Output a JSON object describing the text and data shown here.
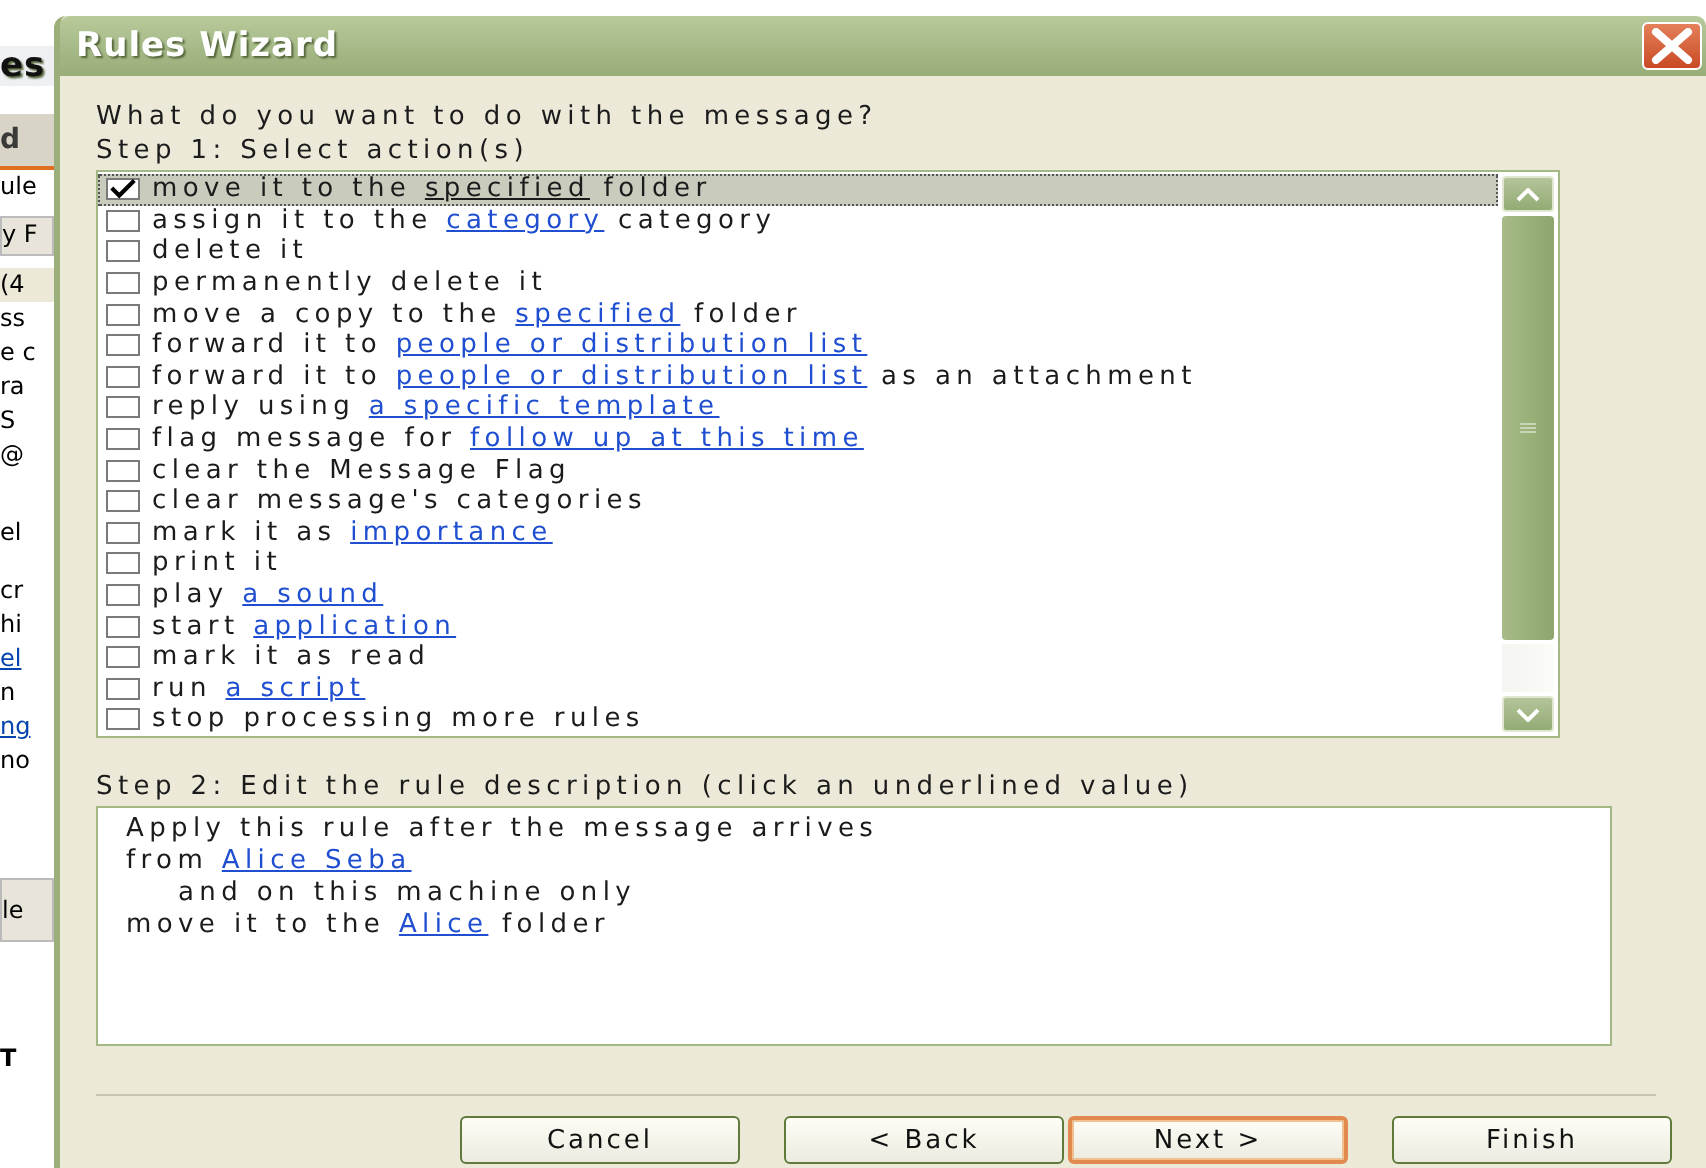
{
  "background_window": {
    "fragments": [
      {
        "text": "es",
        "kind": "title"
      },
      {
        "text": "d",
        "kind": "tab"
      },
      {
        "text": "ule",
        "kind": "text"
      },
      {
        "text": "y F",
        "kind": "button"
      },
      {
        "text": "(4",
        "kind": "header"
      },
      {
        "text": "ss",
        "kind": "text"
      },
      {
        "text": "e c",
        "kind": "text"
      },
      {
        "text": "ra",
        "kind": "text"
      },
      {
        "text": "S",
        "kind": "text"
      },
      {
        "text": "@",
        "kind": "text"
      },
      {
        "text": "el",
        "kind": "text"
      },
      {
        "text": "cr",
        "kind": "text"
      },
      {
        "text": "hi",
        "kind": "text"
      },
      {
        "text": "el",
        "kind": "link"
      },
      {
        "text": "n",
        "kind": "text"
      },
      {
        "text": "ng",
        "kind": "link"
      },
      {
        "text": "no",
        "kind": "text"
      },
      {
        "text": "le",
        "kind": "button"
      },
      {
        "text": "T",
        "kind": "text"
      }
    ]
  },
  "window": {
    "title": "Rules Wizard"
  },
  "question": "What do you want to do with the message?",
  "step1": {
    "label": "Step 1: Select action(s)",
    "actions": [
      {
        "checked": true,
        "selected": true,
        "parts": [
          {
            "kind": "text",
            "text": "move it to the "
          },
          {
            "kind": "link",
            "text": "specified"
          },
          {
            "kind": "text",
            "text": " folder"
          }
        ]
      },
      {
        "checked": false,
        "selected": false,
        "parts": [
          {
            "kind": "text",
            "text": "assign it to the "
          },
          {
            "kind": "link",
            "text": "category"
          },
          {
            "kind": "text",
            "text": " category"
          }
        ]
      },
      {
        "checked": false,
        "selected": false,
        "parts": [
          {
            "kind": "text",
            "text": "delete it"
          }
        ]
      },
      {
        "checked": false,
        "selected": false,
        "parts": [
          {
            "kind": "text",
            "text": "permanently delete it"
          }
        ]
      },
      {
        "checked": false,
        "selected": false,
        "parts": [
          {
            "kind": "text",
            "text": "move a copy to the "
          },
          {
            "kind": "link",
            "text": "specified"
          },
          {
            "kind": "text",
            "text": " folder"
          }
        ]
      },
      {
        "checked": false,
        "selected": false,
        "parts": [
          {
            "kind": "text",
            "text": "forward it to "
          },
          {
            "kind": "link",
            "text": "people or distribution list"
          }
        ]
      },
      {
        "checked": false,
        "selected": false,
        "parts": [
          {
            "kind": "text",
            "text": "forward it to "
          },
          {
            "kind": "link",
            "text": "people or distribution list"
          },
          {
            "kind": "text",
            "text": " as an attachment"
          }
        ]
      },
      {
        "checked": false,
        "selected": false,
        "parts": [
          {
            "kind": "text",
            "text": "reply using "
          },
          {
            "kind": "link",
            "text": "a specific template"
          }
        ]
      },
      {
        "checked": false,
        "selected": false,
        "parts": [
          {
            "kind": "text",
            "text": "flag message for "
          },
          {
            "kind": "link",
            "text": "follow up at this time"
          }
        ]
      },
      {
        "checked": false,
        "selected": false,
        "parts": [
          {
            "kind": "text",
            "text": "clear the Message Flag"
          }
        ]
      },
      {
        "checked": false,
        "selected": false,
        "parts": [
          {
            "kind": "text",
            "text": "clear message's categories"
          }
        ]
      },
      {
        "checked": false,
        "selected": false,
        "parts": [
          {
            "kind": "text",
            "text": "mark it as "
          },
          {
            "kind": "link",
            "text": "importance"
          }
        ]
      },
      {
        "checked": false,
        "selected": false,
        "parts": [
          {
            "kind": "text",
            "text": "print it"
          }
        ]
      },
      {
        "checked": false,
        "selected": false,
        "parts": [
          {
            "kind": "text",
            "text": "play "
          },
          {
            "kind": "link",
            "text": "a sound"
          }
        ]
      },
      {
        "checked": false,
        "selected": false,
        "parts": [
          {
            "kind": "text",
            "text": "start "
          },
          {
            "kind": "link",
            "text": "application"
          }
        ]
      },
      {
        "checked": false,
        "selected": false,
        "parts": [
          {
            "kind": "text",
            "text": "mark it as read"
          }
        ]
      },
      {
        "checked": false,
        "selected": false,
        "parts": [
          {
            "kind": "text",
            "text": "run "
          },
          {
            "kind": "link",
            "text": "a script"
          }
        ]
      },
      {
        "checked": false,
        "selected": false,
        "parts": [
          {
            "kind": "text",
            "text": "stop processing more rules"
          }
        ]
      }
    ]
  },
  "step2": {
    "label": "Step 2: Edit the rule description (click an underlined value)",
    "lines": [
      {
        "indented": false,
        "parts": [
          {
            "kind": "text",
            "text": "Apply this rule after the message arrives"
          }
        ]
      },
      {
        "indented": false,
        "parts": [
          {
            "kind": "text",
            "text": "from "
          },
          {
            "kind": "link",
            "text": "Alice Seba"
          }
        ]
      },
      {
        "indented": true,
        "parts": [
          {
            "kind": "text",
            "text": "and on this machine only"
          }
        ]
      },
      {
        "indented": false,
        "parts": [
          {
            "kind": "text",
            "text": "move it to the "
          },
          {
            "kind": "link",
            "text": "Alice"
          },
          {
            "kind": "text",
            "text": " folder"
          }
        ]
      }
    ]
  },
  "buttons": [
    {
      "label": "Cancel",
      "default": false
    },
    {
      "label": "< Back",
      "default": false
    },
    {
      "label": "Next >",
      "default": true
    },
    {
      "label": "Finish",
      "default": false
    }
  ]
}
